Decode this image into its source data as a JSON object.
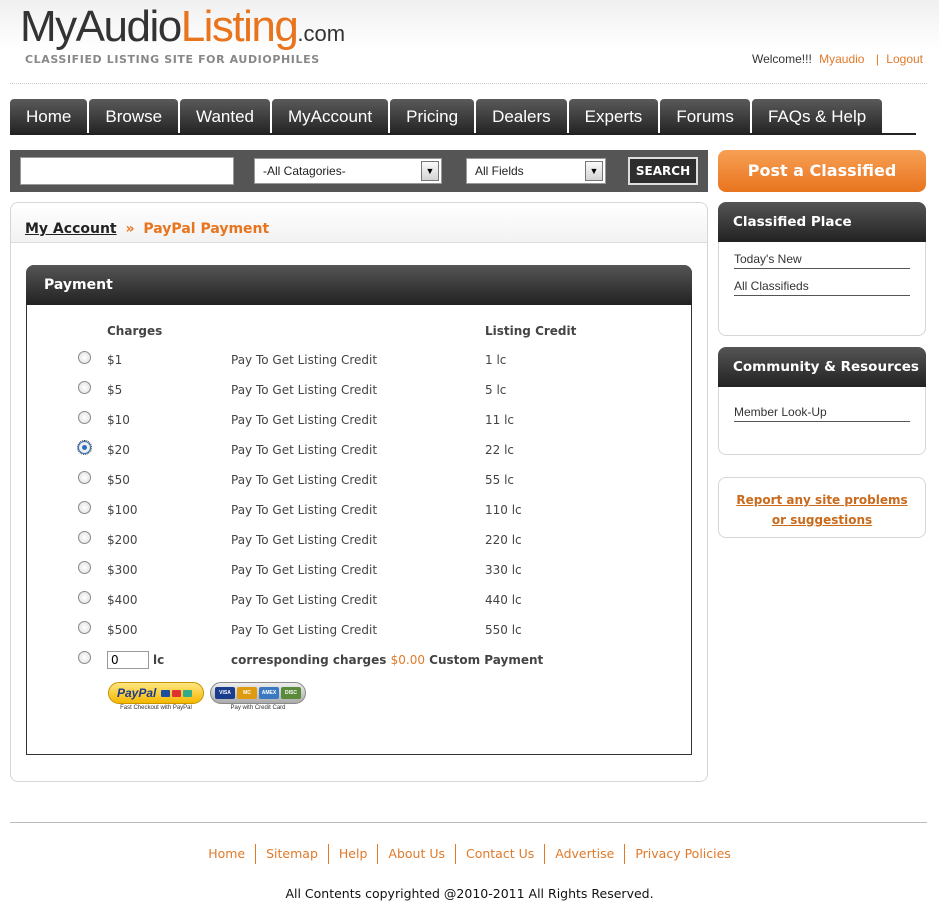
{
  "header": {
    "logo_my": "MyAudio",
    "logo_listing": "Listing",
    "logo_com": ".com",
    "tagline": "CLASSIFIED LISTING SITE FOR AUDIOPHILES",
    "welcome_text": "Welcome!!!",
    "username": "Myaudio",
    "separator": "|",
    "logout": "Logout"
  },
  "nav": {
    "tabs": [
      {
        "label": "Home"
      },
      {
        "label": "Browse"
      },
      {
        "label": "Wanted"
      },
      {
        "label": "MyAccount"
      },
      {
        "label": "Pricing"
      },
      {
        "label": "Dealers"
      },
      {
        "label": "Experts"
      },
      {
        "label": "Forums"
      },
      {
        "label": "FAQs & Help"
      }
    ]
  },
  "search": {
    "query": "",
    "category_selected": "-All Catagories-",
    "field_selected": "All Fields",
    "button_label": "SEARCH"
  },
  "breadcrumb": {
    "root": "My Account",
    "separator": "»",
    "current": "PayPal Payment"
  },
  "payment": {
    "title": "Payment",
    "col_charges": "Charges",
    "col_credit": "Listing Credit",
    "rows": [
      {
        "charge": "$1",
        "desc": "Pay To Get Listing Credit",
        "credit": "1 lc",
        "selected": false
      },
      {
        "charge": "$5",
        "desc": "Pay To Get Listing Credit",
        "credit": "5 lc",
        "selected": false
      },
      {
        "charge": "$10",
        "desc": "Pay To Get Listing Credit",
        "credit": "11 lc",
        "selected": false
      },
      {
        "charge": "$20",
        "desc": "Pay To Get Listing Credit",
        "credit": "22 lc",
        "selected": true
      },
      {
        "charge": "$50",
        "desc": "Pay To Get Listing Credit",
        "credit": "55 lc",
        "selected": false
      },
      {
        "charge": "$100",
        "desc": "Pay To Get Listing Credit",
        "credit": "110 lc",
        "selected": false
      },
      {
        "charge": "$200",
        "desc": "Pay To Get Listing Credit",
        "credit": "220 lc",
        "selected": false
      },
      {
        "charge": "$300",
        "desc": "Pay To Get Listing Credit",
        "credit": "330 lc",
        "selected": false
      },
      {
        "charge": "$400",
        "desc": "Pay To Get Listing Credit",
        "credit": "440 lc",
        "selected": false
      },
      {
        "charge": "$500",
        "desc": "Pay To Get Listing Credit",
        "credit": "550 lc",
        "selected": false
      }
    ],
    "custom": {
      "value": "0",
      "unit": "lc",
      "prefix": "corresponding charges",
      "amount": "$0.00",
      "suffix": "Custom Payment"
    },
    "paypal_button": {
      "label": "PayPal",
      "caption": "Fast Checkout with PayPal"
    },
    "card_button": {
      "cards": [
        "VISA",
        "MC",
        "AMEX",
        "DISC"
      ],
      "caption": "Pay with Credit Card"
    }
  },
  "sidebar": {
    "post_button": "Post a Classified",
    "classified_place": {
      "title": "Classified Place",
      "links": [
        "Today's New",
        "All Classifieds"
      ]
    },
    "community": {
      "title": "Community & Resources",
      "links": [
        "Member Look-Up"
      ]
    },
    "report": {
      "line1": "Report any site problems",
      "line2": "or suggestions"
    }
  },
  "footer": {
    "links": [
      "Home",
      "Sitemap",
      "Help",
      "About Us",
      "Contact Us",
      "Advertise",
      "Privacy Policies"
    ],
    "copyright": "All Contents copyrighted @2010-2011 All Rights Reserved."
  },
  "colors": {
    "accent": "#e8741e",
    "dark": "#222222",
    "link": "#e07a2a"
  }
}
